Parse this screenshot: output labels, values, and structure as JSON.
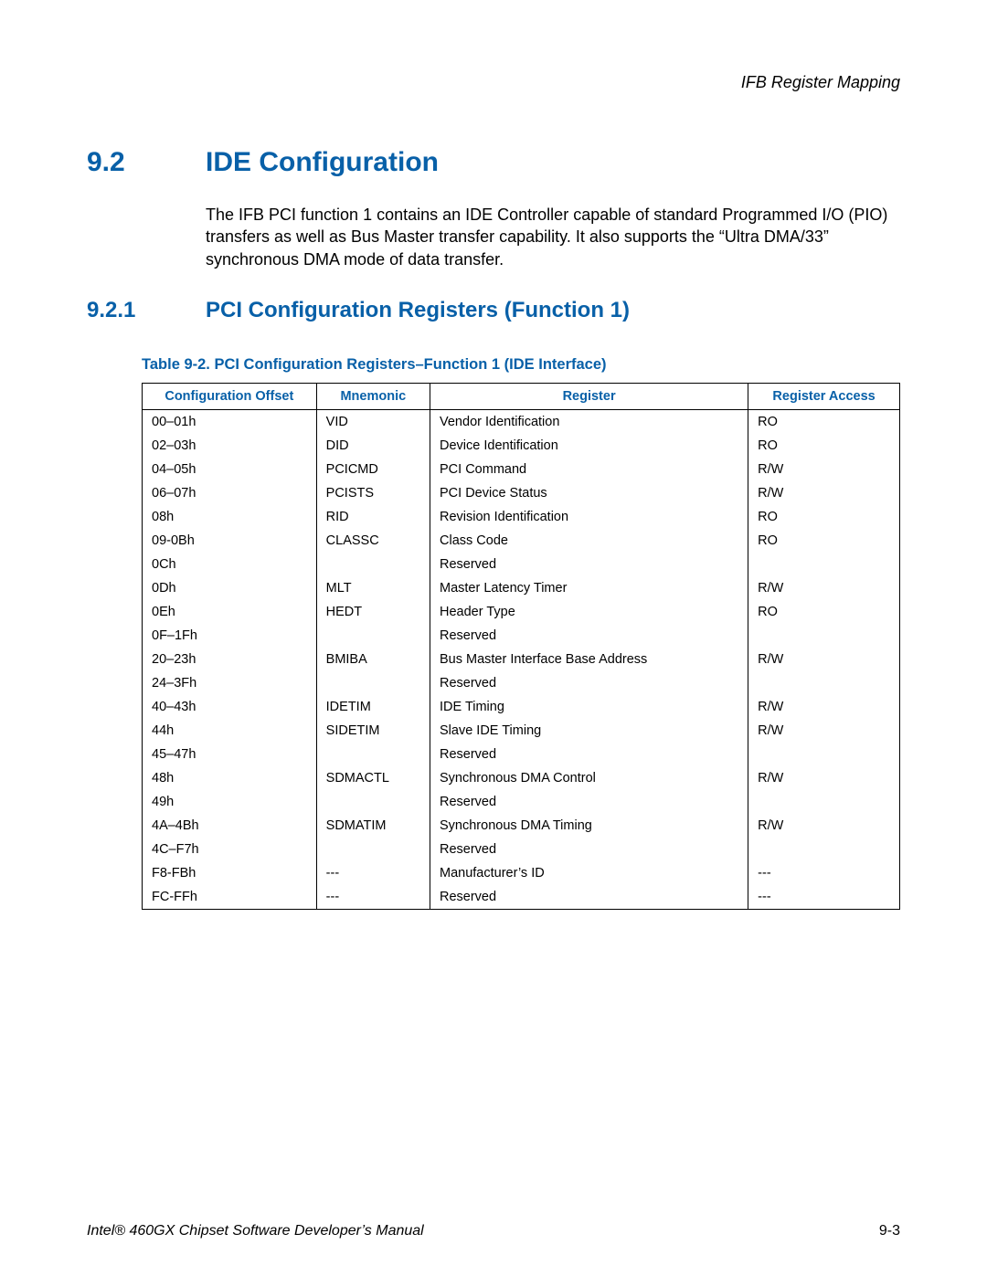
{
  "header": {
    "chapter_title": "IFB Register Mapping"
  },
  "section": {
    "number": "9.2",
    "title": "IDE Configuration",
    "body": "The IFB PCI function 1 contains an IDE Controller capable of standard Programmed I/O (PIO) transfers as well as Bus Master transfer capability. It also supports the “Ultra DMA/33” synchronous DMA mode of data transfer."
  },
  "subsection": {
    "number": "9.2.1",
    "title": "PCI Configuration Registers (Function 1)"
  },
  "table": {
    "caption": "Table 9-2. PCI Configuration Registers–Function 1 (IDE Interface)",
    "headers": [
      "Configuration Offset",
      "Mnemonic",
      "Register",
      "Register Access"
    ],
    "rows": [
      [
        "00–01h",
        "VID",
        "Vendor Identification",
        "RO"
      ],
      [
        "02–03h",
        "DID",
        "Device Identification",
        "RO"
      ],
      [
        "04–05h",
        "PCICMD",
        "PCI Command",
        "R/W"
      ],
      [
        "06–07h",
        "PCISTS",
        "PCI Device Status",
        "R/W"
      ],
      [
        "08h",
        "RID",
        "Revision Identification",
        "RO"
      ],
      [
        "09-0Bh",
        "CLASSC",
        "Class Code",
        "RO"
      ],
      [
        "0Ch",
        "",
        "Reserved",
        ""
      ],
      [
        "0Dh",
        "MLT",
        "Master Latency Timer",
        "R/W"
      ],
      [
        "0Eh",
        "HEDT",
        "Header Type",
        "RO"
      ],
      [
        "0F–1Fh",
        "",
        "Reserved",
        ""
      ],
      [
        "20–23h",
        "BMIBA",
        "Bus Master Interface Base Address",
        "R/W"
      ],
      [
        "24–3Fh",
        "",
        "Reserved",
        ""
      ],
      [
        "40–43h",
        "IDETIM",
        "IDE Timing",
        "R/W"
      ],
      [
        "44h",
        "SIDETIM",
        "Slave IDE Timing",
        "R/W"
      ],
      [
        "45–47h",
        "",
        "Reserved",
        ""
      ],
      [
        "48h",
        "SDMACTL",
        "Synchronous DMA Control",
        "R/W"
      ],
      [
        "49h",
        "",
        "Reserved",
        ""
      ],
      [
        "4A–4Bh",
        "SDMATIM",
        "Synchronous DMA Timing",
        "R/W"
      ],
      [
        "4C–F7h",
        "",
        "Reserved",
        ""
      ],
      [
        "F8-FBh",
        "---",
        "Manufacturer’s ID",
        "---"
      ],
      [
        "FC-FFh",
        "---",
        "Reserved",
        "---"
      ]
    ]
  },
  "footer": {
    "manual": "Intel® 460GX Chipset Software Developer’s Manual",
    "page": "9-3"
  }
}
